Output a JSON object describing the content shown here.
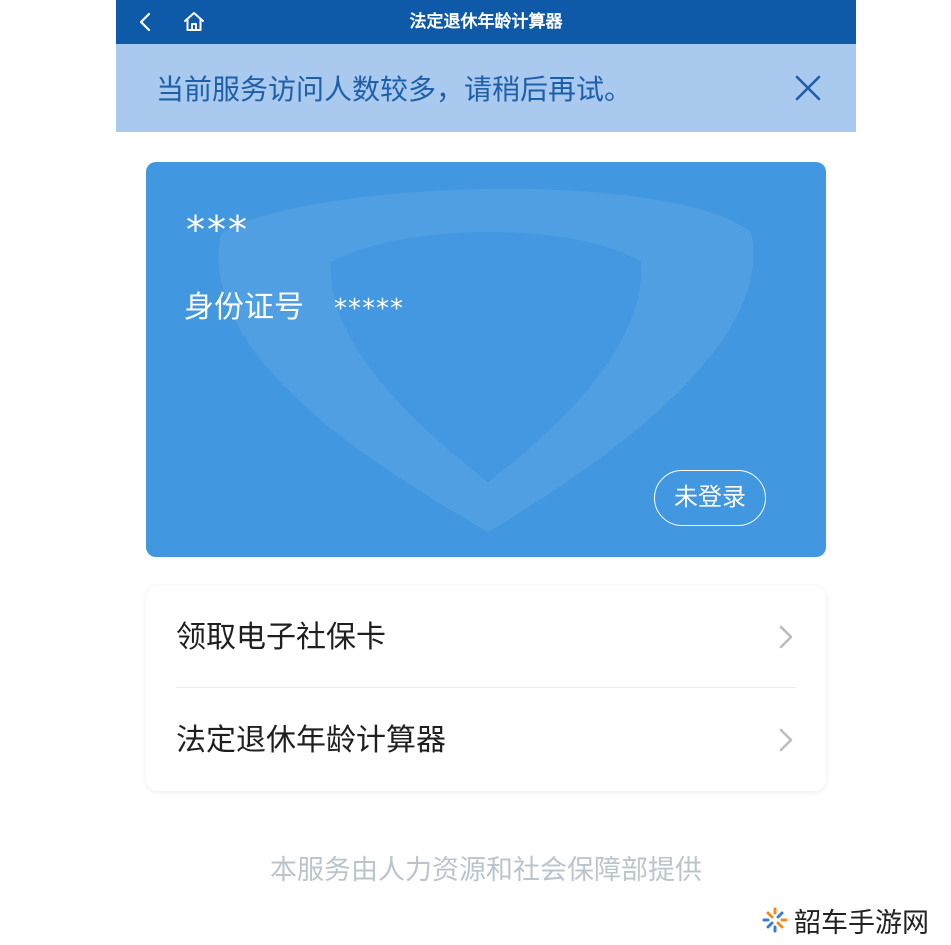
{
  "header": {
    "title": "法定退休年龄计算器",
    "back_icon": "chevron-left-icon",
    "home_icon": "home-icon"
  },
  "notice": {
    "message": "当前服务访问人数较多，请稍后再试。",
    "close_icon": "close-icon"
  },
  "card": {
    "name": "***",
    "id_label": "身份证号",
    "id_value": "*****",
    "login_button": "未登录"
  },
  "menu": {
    "items": [
      {
        "label": "领取电子社保卡",
        "icon": "chevron-right-icon"
      },
      {
        "label": "法定退休年龄计算器",
        "icon": "chevron-right-icon"
      }
    ]
  },
  "footer": {
    "text": "本服务由人力资源和社会保障部提供"
  },
  "watermark": {
    "text": "韶车手游网"
  },
  "colors": {
    "header": "#0f5aa8",
    "notice_bg": "#a9c9ee",
    "notice_text": "#1d5fa8",
    "card": "#4197e0",
    "footer_text": "#b9c4cc"
  }
}
